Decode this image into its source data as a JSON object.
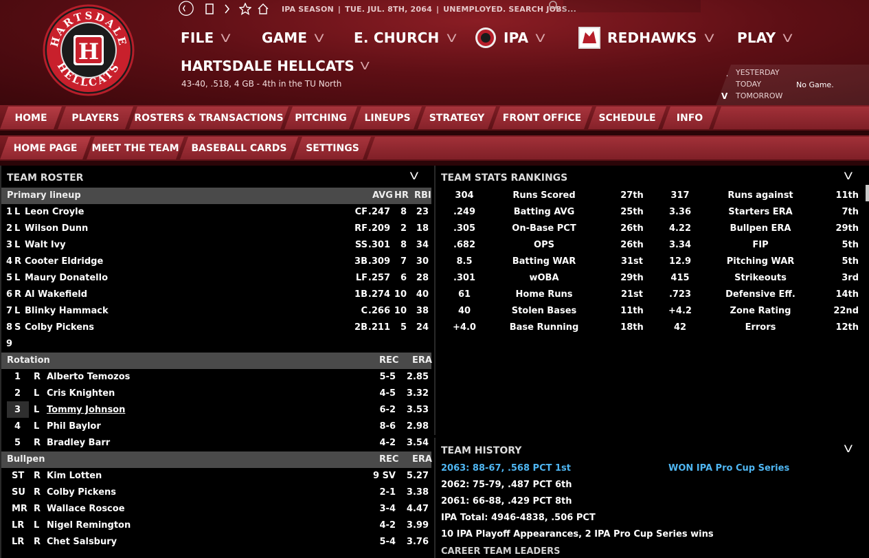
{
  "topbar": {
    "season": "IPA SEASON",
    "date": "TUE. JUL. 8TH, 2064",
    "status": "UNEMPLOYED. SEARCH JOBS...",
    "search_placeholder": ""
  },
  "menu": {
    "file": "FILE",
    "game": "GAME",
    "manager": "E. CHURCH",
    "league": "IPA",
    "team": "REDHAWKS",
    "play": "PLAY"
  },
  "team": {
    "name": "HARTSDALE HELLCATS",
    "record": "43-40, .518, 4 GB - 4th in the TU North",
    "logo_top": "HARTSDALE",
    "logo_bottom": "HELLCATS",
    "logo_letter": "H"
  },
  "daynav": {
    "yesterday": "YESTERDAY",
    "today": "TODAY",
    "tomorrow": "TOMORROW",
    "today_value": "No Game."
  },
  "nav1": [
    "HOME",
    "PLAYERS",
    "ROSTERS & TRANSACTIONS",
    "PITCHING",
    "LINEUPS",
    "STRATEGY",
    "FRONT OFFICE",
    "SCHEDULE",
    "INFO"
  ],
  "nav2": [
    "HOME PAGE",
    "MEET THE TEAM",
    "BASEBALL CARDS",
    "SETTINGS"
  ],
  "roster": {
    "title": "TEAM ROSTER",
    "lineup_header": {
      "label": "Primary lineup",
      "avg": "AVG",
      "hr": "HR",
      "rbi": "RBI"
    },
    "lineup": [
      {
        "n": "1",
        "hand": "L",
        "name": "Leon Croyle",
        "pos": "CF",
        "avg": ".247",
        "hr": "8",
        "rbi": "23"
      },
      {
        "n": "2",
        "hand": "L",
        "name": "Wilson Dunn",
        "pos": "RF",
        "avg": ".209",
        "hr": "2",
        "rbi": "18"
      },
      {
        "n": "3",
        "hand": "L",
        "name": "Walt Ivy",
        "pos": "SS",
        "avg": ".301",
        "hr": "8",
        "rbi": "34"
      },
      {
        "n": "4",
        "hand": "R",
        "name": "Cooter Eldridge",
        "pos": "3B",
        "avg": ".309",
        "hr": "7",
        "rbi": "30"
      },
      {
        "n": "5",
        "hand": "L",
        "name": "Maury Donatello",
        "pos": "LF",
        "avg": ".257",
        "hr": "6",
        "rbi": "28"
      },
      {
        "n": "6",
        "hand": "R",
        "name": "Al Wakefield",
        "pos": "1B",
        "avg": ".274",
        "hr": "10",
        "rbi": "40"
      },
      {
        "n": "7",
        "hand": "L",
        "name": "Blinky Hammack",
        "pos": "C",
        "avg": ".266",
        "hr": "10",
        "rbi": "38"
      },
      {
        "n": "8",
        "hand": "S",
        "name": "Colby Pickens",
        "pos": "2B",
        "avg": ".211",
        "hr": "5",
        "rbi": "24"
      },
      {
        "n": "9",
        "hand": "",
        "name": "",
        "pos": "",
        "avg": "",
        "hr": "",
        "rbi": ""
      }
    ],
    "rotation_header": {
      "label": "Rotation",
      "rec": "REC",
      "era": "ERA"
    },
    "rotation": [
      {
        "n": "1",
        "hand": "R",
        "name": "Alberto Temozos",
        "rec": "5-5",
        "era": "2.85"
      },
      {
        "n": "2",
        "hand": "L",
        "name": "Cris Knighten",
        "rec": "4-5",
        "era": "3.32"
      },
      {
        "n": "3",
        "hand": "L",
        "name": "Tommy Johnson",
        "rec": "6-2",
        "era": "3.53"
      },
      {
        "n": "4",
        "hand": "L",
        "name": "Phil Baylor",
        "rec": "8-6",
        "era": "2.98"
      },
      {
        "n": "5",
        "hand": "R",
        "name": "Bradley Barr",
        "rec": "4-2",
        "era": "3.54"
      }
    ],
    "bullpen_header": {
      "label": "Bullpen",
      "rec": "REC",
      "era": "ERA"
    },
    "bullpen": [
      {
        "role": "ST",
        "hand": "R",
        "name": "Kim Lotten",
        "rec": "9 SV",
        "era": "5.27"
      },
      {
        "role": "SU",
        "hand": "R",
        "name": "Colby Pickens",
        "rec": "2-1",
        "era": "3.38"
      },
      {
        "role": "MR",
        "hand": "R",
        "name": "Wallace Roscoe",
        "rec": "3-4",
        "era": "4.47"
      },
      {
        "role": "LR",
        "hand": "L",
        "name": "Nigel Remington",
        "rec": "4-2",
        "era": "3.99"
      },
      {
        "role": "LR",
        "hand": "R",
        "name": "Chet Salsbury",
        "rec": "5-4",
        "era": "3.76"
      }
    ]
  },
  "stats": {
    "title": "TEAM STATS RANKINGS",
    "rows": [
      {
        "v1": "304",
        "l1": "Runs Scored",
        "r1": "27th",
        "v2": "317",
        "l2": "Runs against",
        "r2": "11th"
      },
      {
        "v1": ".249",
        "l1": "Batting AVG",
        "r1": "25th",
        "v2": "3.36",
        "l2": "Starters ERA",
        "r2": "7th"
      },
      {
        "v1": ".305",
        "l1": "On-Base PCT",
        "r1": "26th",
        "v2": "4.22",
        "l2": "Bullpen ERA",
        "r2": "29th"
      },
      {
        "v1": ".682",
        "l1": "OPS",
        "r1": "26th",
        "v2": "3.34",
        "l2": "FIP",
        "r2": "5th"
      },
      {
        "v1": "8.5",
        "l1": "Batting WAR",
        "r1": "31st",
        "v2": "12.9",
        "l2": "Pitching WAR",
        "r2": "5th"
      },
      {
        "v1": ".301",
        "l1": "wOBA",
        "r1": "29th",
        "v2": "415",
        "l2": "Strikeouts",
        "r2": "3rd"
      },
      {
        "v1": "61",
        "l1": "Home Runs",
        "r1": "21st",
        "v2": ".723",
        "l2": "Defensive Eff.",
        "r2": "14th"
      },
      {
        "v1": "40",
        "l1": "Stolen Bases",
        "r1": "11th",
        "v2": "+4.2",
        "l2": "Zone Rating",
        "r2": "22nd"
      },
      {
        "v1": "+4.0",
        "l1": "Base Running",
        "r1": "18th",
        "v2": "42",
        "l2": "Errors",
        "r2": "12th"
      }
    ]
  },
  "history": {
    "title": "TEAM HISTORY",
    "line1": "2063: 88-67, .568 PCT 1st",
    "line1_right": "WON IPA Pro Cup Series",
    "line2": "2062: 75-79, .487 PCT 6th",
    "line3": "2061: 66-88, .429 PCT 8th",
    "line4": "IPA Total: 4946-4838, .506 PCT",
    "line5": "10 IPA Playoff Appearances, 2 IPA Pro Cup Series wins",
    "line6": "CAREER TEAM LEADERS"
  },
  "colors": {
    "header": "#5e0f15",
    "tab": "#a8343c",
    "section_header": "#4a4a4a",
    "link_blue": "#4fb6f2"
  }
}
